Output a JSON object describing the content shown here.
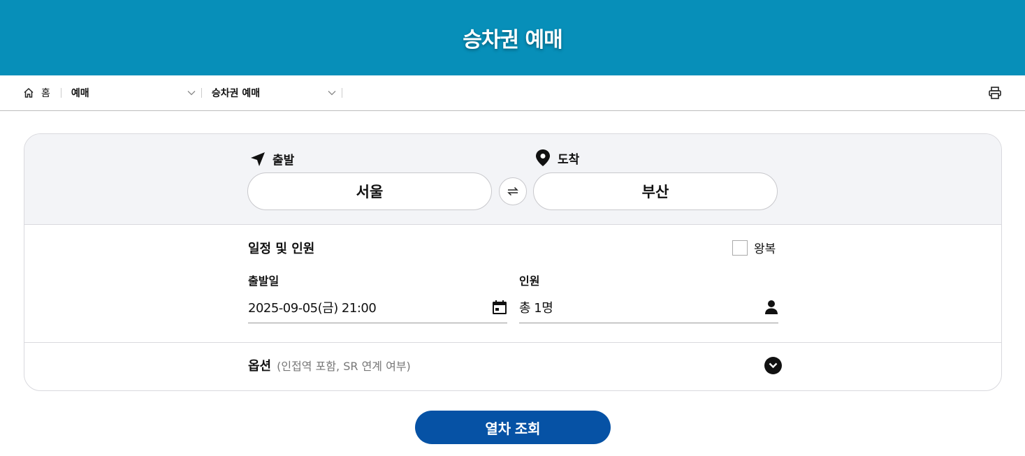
{
  "header": {
    "title": "승차권 예매"
  },
  "breadcrumb": {
    "home_label": "홈",
    "level1": "예매",
    "level2": "승차권 예매"
  },
  "route": {
    "departure_label": "출발",
    "arrival_label": "도착",
    "departure_station": "서울",
    "arrival_station": "부산"
  },
  "schedule": {
    "title": "일정 및 인원",
    "roundtrip_label": "왕복",
    "roundtrip_checked": false,
    "date_label": "출발일",
    "date_value": "2025-09-05(금) 21:00",
    "passenger_label": "인원",
    "passenger_value": "총 1명"
  },
  "options": {
    "title": "옵션",
    "subtitle": "(인접역 포함, SR 연계 여부)"
  },
  "search_button": "열차 조회",
  "colors": {
    "header_bg": "#078fb9",
    "primary_button": "#0652a5",
    "panel_bg": "#f3f4f7"
  },
  "icons": [
    "home-icon",
    "chevron-down-icon",
    "print-icon",
    "departure-arrow-icon",
    "location-pin-icon",
    "swap-icon",
    "calendar-icon",
    "person-icon",
    "chevron-down-circle-icon"
  ]
}
